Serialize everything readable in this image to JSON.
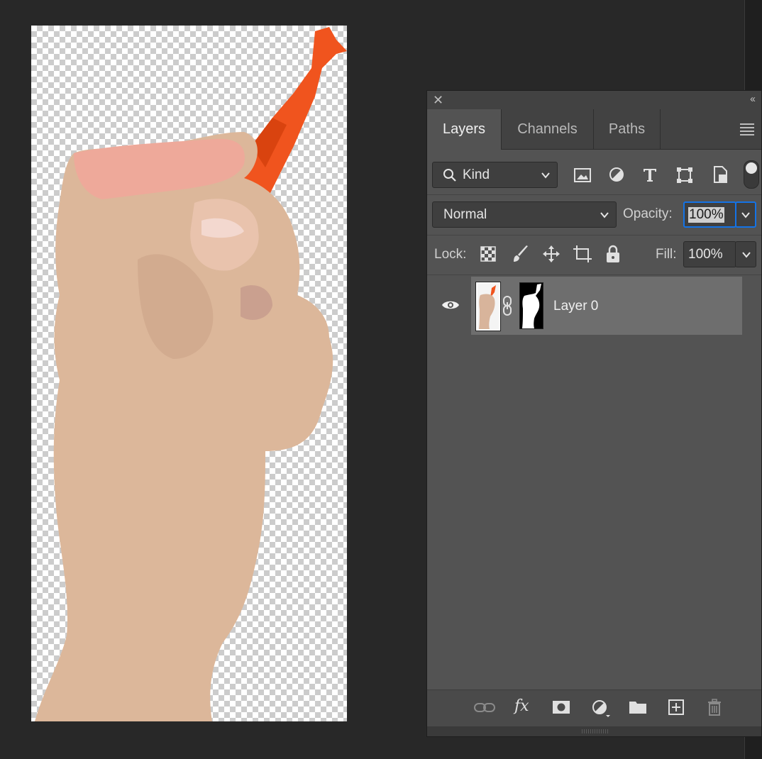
{
  "panel": {
    "tabs": [
      {
        "label": "Layers",
        "active": true
      },
      {
        "label": "Channels",
        "active": false
      },
      {
        "label": "Paths",
        "active": false
      }
    ],
    "filter": {
      "value": "Kind",
      "icons": [
        "image-filter-icon",
        "adjustment-filter-icon",
        "type-filter-icon",
        "shape-filter-icon",
        "smart-object-filter-icon"
      ]
    },
    "blend_mode": "Normal",
    "opacity_label": "Opacity:",
    "opacity_value": "100%",
    "lock_label": "Lock:",
    "fill_label": "Fill:",
    "fill_value": "100%",
    "layers": [
      {
        "name": "Layer 0",
        "visible": true,
        "has_mask": true
      }
    ],
    "footer_icons": [
      "link-layers-icon",
      "fx-icon",
      "add-mask-icon",
      "adjustment-layer-icon",
      "new-group-icon",
      "new-layer-icon",
      "delete-layer-icon"
    ],
    "fx_label": "fx"
  },
  "colors": {
    "panel_bg": "#535353",
    "selected_layer": "#6e6e6e",
    "accent_focus": "#1473e6",
    "tool_orange": "#f0541e"
  }
}
